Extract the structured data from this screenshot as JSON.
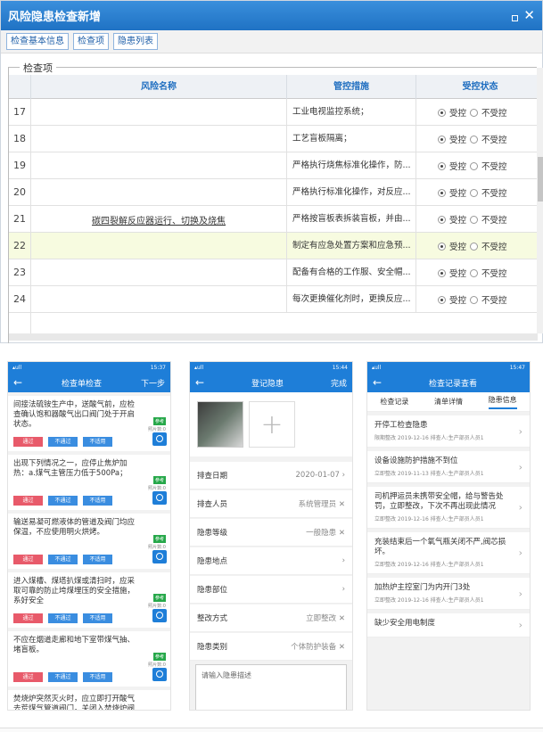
{
  "window": {
    "title": "风险隐患检查新增",
    "tabs": [
      "检查基本信息",
      "检查项",
      "隐患列表"
    ],
    "legend": "检查项",
    "headers": [
      "风险名称",
      "管控措施",
      "受控状态"
    ],
    "risk_name": "碳四裂解反应器运行、切换及烧焦",
    "radio_on": "受控",
    "radio_off": "不受控",
    "rows": [
      {
        "no": "17",
        "measure": "工业电视监控系统；"
      },
      {
        "no": "18",
        "measure": "工艺盲板隔离；"
      },
      {
        "no": "19",
        "measure": "严格执行烧焦标准化操作，防..."
      },
      {
        "no": "20",
        "measure": "严格执行标准化操作，对反应..."
      },
      {
        "no": "21",
        "measure": "严格按盲板表拆装盲板，并由..."
      },
      {
        "no": "22",
        "measure": "制定有应急处置方案和应急预..."
      },
      {
        "no": "23",
        "measure": "配备有合格的工作服、安全帽..."
      },
      {
        "no": "24",
        "measure": "每次更换催化剂时，更换反应..."
      }
    ]
  },
  "phone1": {
    "status_time": "15:37",
    "title": "检查单检查",
    "next": "下一步",
    "tag": "参考",
    "photo": "照片数:0",
    "btn_pass": "通过",
    "btn_fail": "不通过",
    "btn_na": "不适用",
    "items": [
      "间接法硫铵生产中，送酸气前，应检查确认饱和器酸气出口阀门处于开启状态。",
      "出现下列情况之一，应停止焦炉加热：a.煤气主管压力低于500Pa；",
      "输送易凝可燃液体的管道及阀门均应保温，不应使用明火烘烤。",
      "进入煤槽、煤塔扒煤或清扫时，应采取可靠的防止垮煤埋压的安全措施，系好安全",
      "不应在烟道走廊和地下室带煤气抽、堵盲板。",
      "焚烧炉突然灭火时，应立即打开酸气去荒煤气管道阀门，关闭入焚烧炉阀门，不应"
    ]
  },
  "phone2": {
    "status_time": "15:44",
    "title": "登记隐患",
    "done": "完成",
    "fields": [
      {
        "label": "排查日期",
        "value": "2020-01-07 ›"
      },
      {
        "label": "排查人员",
        "value": "系统管理员 ✕"
      },
      {
        "label": "隐患等级",
        "value": "一般隐患 ✕"
      },
      {
        "label": "隐患地点",
        "value": "›"
      },
      {
        "label": "隐患部位",
        "value": "›"
      },
      {
        "label": "整改方式",
        "value": "立即整改 ✕"
      },
      {
        "label": "隐患类别",
        "value": "个体防护装备 ✕"
      }
    ],
    "placeholder": "请输入隐患描述"
  },
  "phone3": {
    "status_time": "15:47",
    "title": "检查记录查看",
    "tabs": [
      "检查记录",
      "清单详情",
      "隐患信息"
    ],
    "items": [
      {
        "t": "开停工检查隐患",
        "m": "限期整改   2019-12-16   排查人:生产部员人员1"
      },
      {
        "t": "设备设施防护措施不到位",
        "m": "立即整改   2019-11-13   排查人:生产部员人员1"
      },
      {
        "t": "司机押运员未携带安全帽，给与警告处罚，立即整改，下次不再出现此情况",
        "m": "立即整改   2019-12-16   排查人:生产部员人员1"
      },
      {
        "t": "充装结束后一个氧气瓶关闭不严,阀芯损坏。",
        "m": "立即整改   2019-12-16   排查人:生产部员人员1"
      },
      {
        "t": "加热炉主控室门为内开门3处",
        "m": "立即整改   2019-12-16   排查人:生产部员人员1"
      },
      {
        "t": "缺少安全用电制度",
        "m": ""
      }
    ]
  }
}
